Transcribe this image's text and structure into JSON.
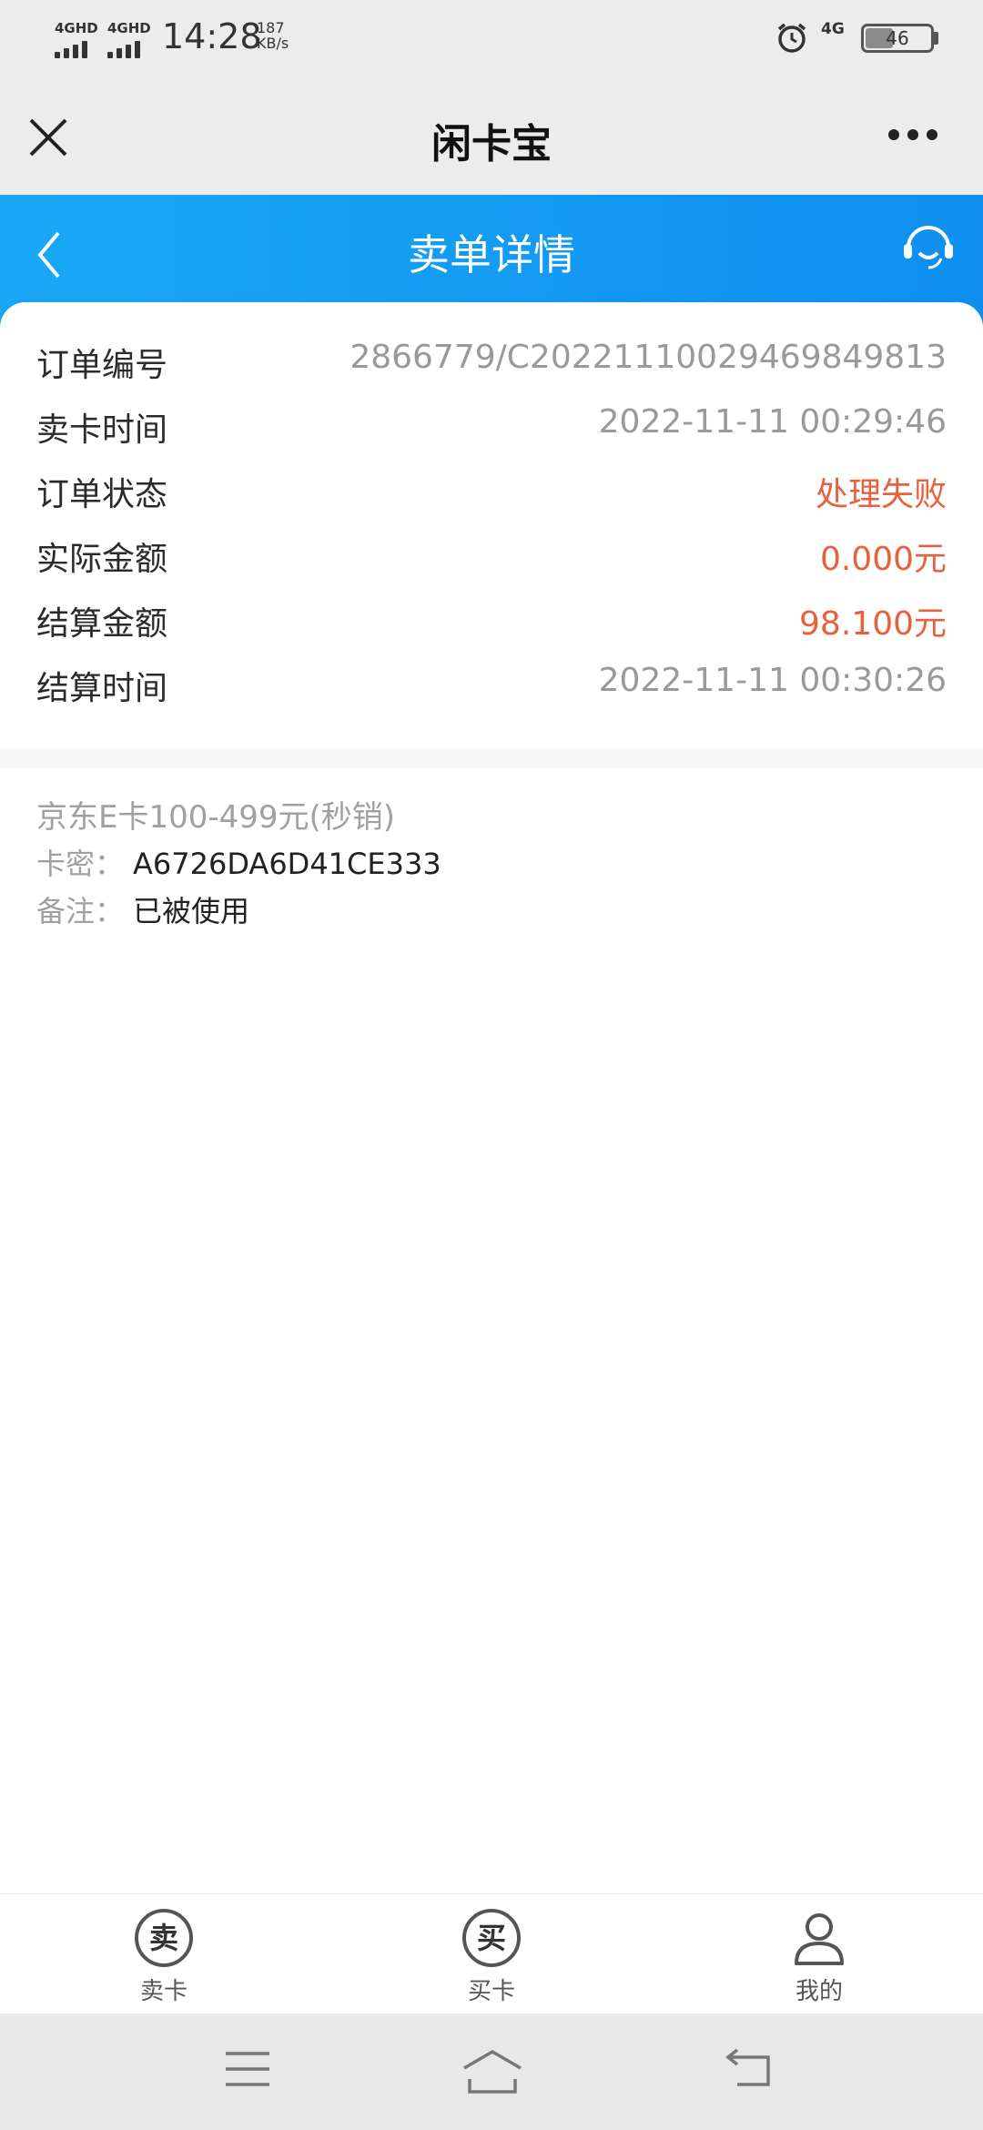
{
  "status_bar": {
    "signal1_label": "4GHD",
    "signal2_label": "4GHD",
    "time": "14:28",
    "speed_value": "187",
    "speed_unit": "KB/s",
    "network": "4G",
    "battery": "46",
    "battery_level": 0.46
  },
  "titlebar": {
    "title": "闲卡宝",
    "close_icon": "close-icon",
    "more_icon": "more-dots-icon"
  },
  "header": {
    "title": "卖单详情",
    "back_icon": "chevron-left-icon",
    "service_icon": "customer-service-icon"
  },
  "order": {
    "rows": [
      {
        "label": "订单编号",
        "value": "2866779/C20221110029469849813",
        "color": "#999999"
      },
      {
        "label": "卖卡时间",
        "value": "2022-11-11 00:29:46",
        "color": "#999999"
      },
      {
        "label": "订单状态",
        "value": "处理失败",
        "color": "#e8613c"
      },
      {
        "label": "实际金额",
        "value": "0.000元",
        "color": "#e8613c"
      },
      {
        "label": "结算金额",
        "value": "98.100元",
        "color": "#e8613c"
      },
      {
        "label": "结算时间",
        "value": "2022-11-11 00:30:26",
        "color": "#999999"
      }
    ]
  },
  "card_info": {
    "product": "京东E卡100-499元(秒销)",
    "secret_label": "卡密：",
    "secret_value": "A6726DA6D41CE333",
    "note_label": "备注：",
    "note_value": "已被使用"
  },
  "tabs": [
    {
      "icon_char": "卖",
      "label": "卖卡"
    },
    {
      "icon_char": "买",
      "label": "买卡"
    },
    {
      "icon": "person-icon",
      "label": "我的"
    }
  ],
  "nav": {
    "menu_icon": "menu-icon",
    "home_icon": "home-icon",
    "back_icon": "back-icon"
  }
}
